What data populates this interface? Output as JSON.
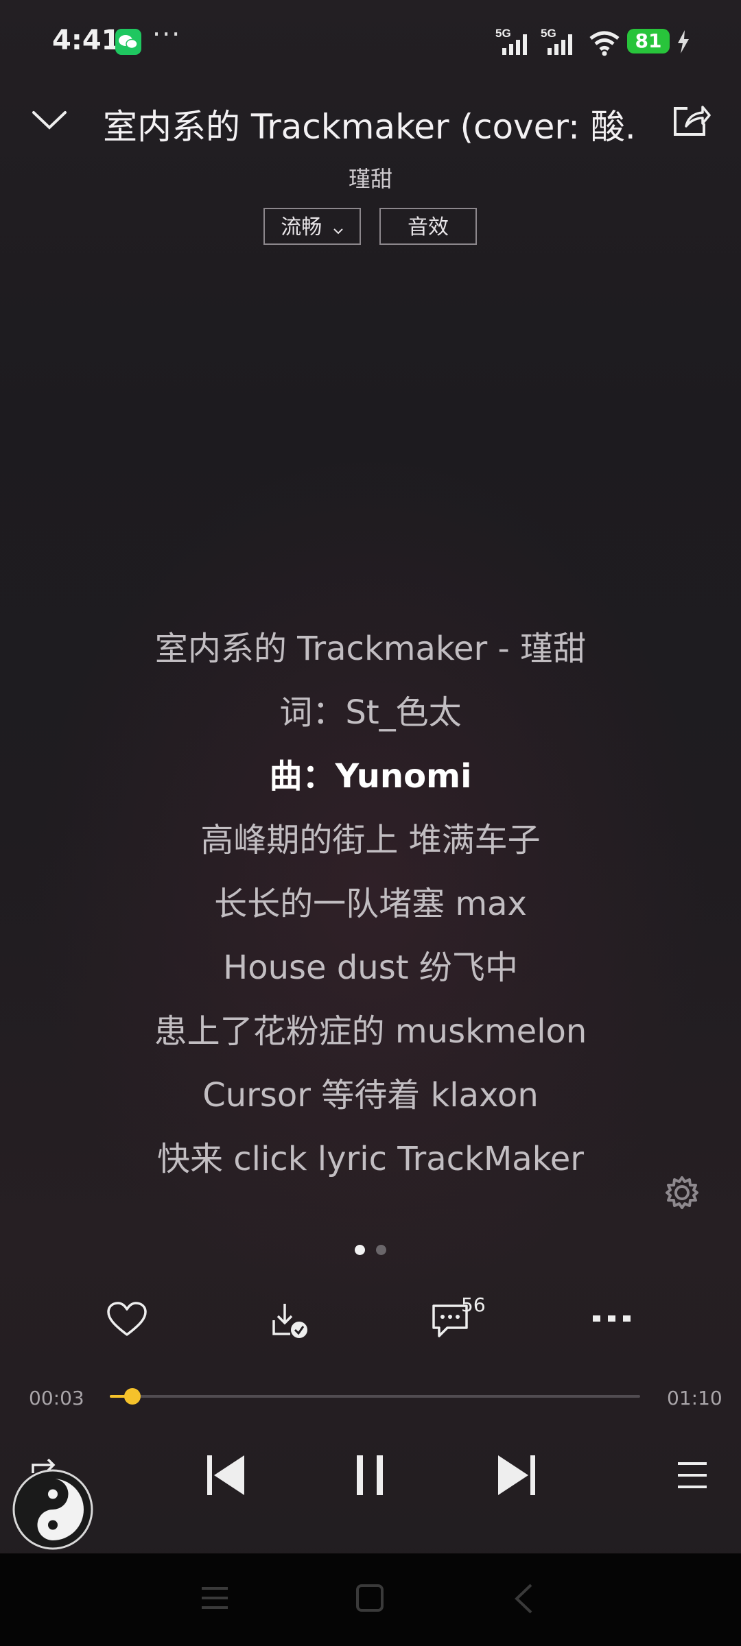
{
  "status_bar": {
    "time": "4:41",
    "more": "···",
    "network": [
      "5G",
      "5G"
    ],
    "battery": "81"
  },
  "header": {
    "title": "室内系的 Trackmaker (cover: 酸..",
    "artist": "瑾甜",
    "quality_label": "流畅",
    "effects_label": "音效"
  },
  "lyrics": [
    "室内系的 Trackmaker - 瑾甜",
    "词：St_色太",
    "曲：Yunomi",
    "高峰期的街上 堆满车子",
    "长长的一队堵塞 max",
    "House dust 纷飞中",
    "患上了花粉症的 muskmelon",
    "Cursor 等待着 klaxon",
    "快来 click lyric TrackMaker"
  ],
  "active_lyric_index": 2,
  "actions": {
    "comment_count": "56"
  },
  "progress": {
    "current": "00:03",
    "total": "01:10",
    "fraction": 0.043
  },
  "colors": {
    "accent": "#f5c22b",
    "battery_green": "#28c43b",
    "wechat_green": "#1fc760"
  },
  "icons": [
    "chevron-down-icon",
    "share-icon",
    "settings-icon",
    "heart-icon",
    "download-done-icon",
    "comment-icon",
    "more-icon",
    "repeat-icon",
    "previous-icon",
    "pause-icon",
    "next-icon",
    "playlist-icon"
  ]
}
